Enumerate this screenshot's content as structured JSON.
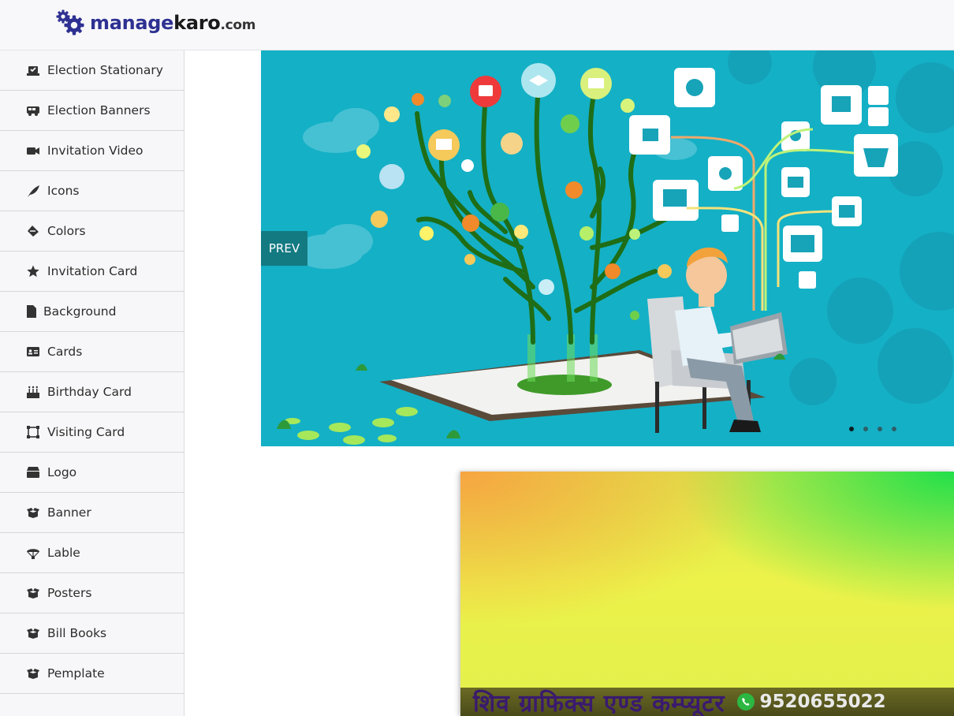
{
  "brand": {
    "manage": "manage",
    "karo": "karo",
    "dotcom": ".com",
    "icon": "gears-icon"
  },
  "sidebar": {
    "items": [
      {
        "label": "Election Stationary",
        "icon": "voting-icon"
      },
      {
        "label": "Election Banners",
        "icon": "bus-icon"
      },
      {
        "label": "Invitation Video",
        "icon": "video-camera-icon"
      },
      {
        "label": "Icons",
        "icon": "feather-icon"
      },
      {
        "label": "Colors",
        "icon": "paint-bucket-icon"
      },
      {
        "label": "Invitation Card",
        "icon": "star-icon"
      },
      {
        "label": "Background",
        "icon": "file-icon"
      },
      {
        "label": "Cards",
        "icon": "id-card-icon"
      },
      {
        "label": "Birthday Card",
        "icon": "birthday-cake-icon"
      },
      {
        "label": "Visiting Card",
        "icon": "vector-square-icon"
      },
      {
        "label": "Logo",
        "icon": "archive-box-icon"
      },
      {
        "label": "Banner",
        "icon": "open-box-icon"
      },
      {
        "label": "Lable",
        "icon": "parachute-icon"
      },
      {
        "label": "Posters",
        "icon": "open-box-icon"
      },
      {
        "label": "Bill Books",
        "icon": "open-box-icon"
      },
      {
        "label": "Pemplate",
        "icon": "open-box-icon"
      }
    ]
  },
  "slider": {
    "prev_label": "PREV",
    "slide_count": 4,
    "active_slide": 1,
    "background_color": "#13b1c7"
  },
  "banner2": {
    "title": "शिव ग्राफिक्स एण्ड कम्प्यूटर",
    "phone": "9520655022"
  },
  "colors": {
    "brand": "#2e3192",
    "prev_button": "#137a82",
    "sidebar_bg": "#f7f7f9"
  }
}
